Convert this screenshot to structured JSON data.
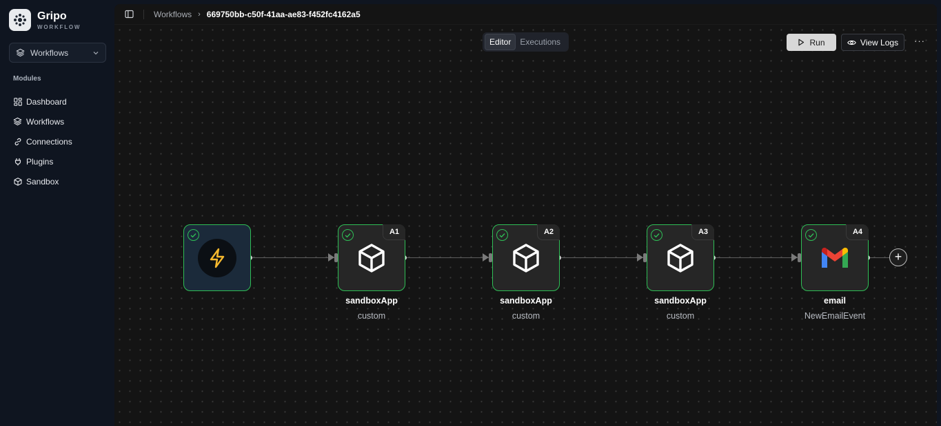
{
  "brand": {
    "name": "Gripo",
    "subtitle": "WORKFLOW"
  },
  "workspace_select": {
    "label": "Workflows"
  },
  "sidebar": {
    "section_title": "Modules",
    "items": [
      {
        "label": "Dashboard",
        "icon": "grid-icon"
      },
      {
        "label": "Workflows",
        "icon": "layers-icon"
      },
      {
        "label": "Connections",
        "icon": "link-icon"
      },
      {
        "label": "Plugins",
        "icon": "plug-icon"
      },
      {
        "label": "Sandbox",
        "icon": "box-icon"
      }
    ]
  },
  "breadcrumb": {
    "parent": "Workflows",
    "current": "669750bb-c50f-41aa-ae83-f452fc4162a5"
  },
  "tabs": [
    {
      "label": "Editor",
      "active": true
    },
    {
      "label": "Executions",
      "active": false
    }
  ],
  "toolbar": {
    "run_label": "Run",
    "logs_label": "View Logs",
    "more_label": "···"
  },
  "nodes": [
    {
      "badge": "",
      "title": "",
      "subtitle": "",
      "icon": "lightning-icon"
    },
    {
      "badge": "A1",
      "title": "sandboxApp",
      "subtitle": "custom",
      "icon": "box-icon"
    },
    {
      "badge": "A2",
      "title": "sandboxApp",
      "subtitle": "custom",
      "icon": "box-icon"
    },
    {
      "badge": "A3",
      "title": "sandboxApp",
      "subtitle": "custom",
      "icon": "box-icon"
    },
    {
      "badge": "A4",
      "title": "email",
      "subtitle": "NewEmailEvent",
      "icon": "gmail-icon"
    }
  ],
  "add_node_label": "+",
  "colors": {
    "success": "#2fbf56",
    "canvas": "#141414",
    "sidebar": "#0f1520",
    "bolt": "#f5b82e"
  }
}
